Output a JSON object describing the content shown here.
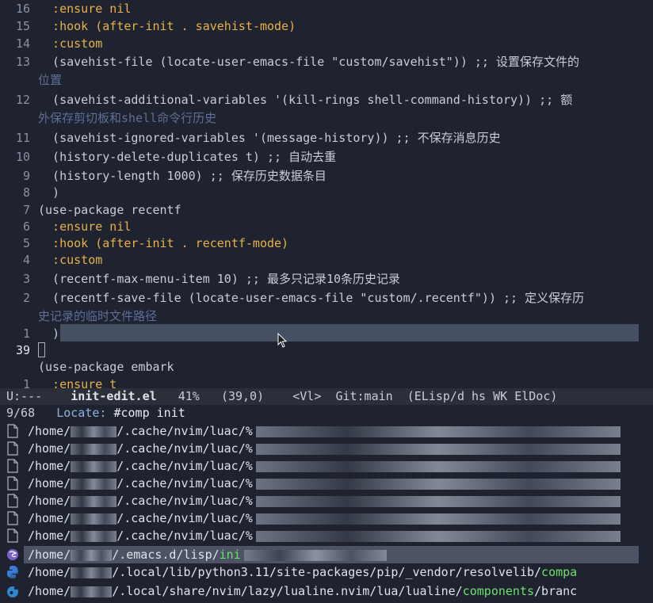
{
  "editor": {
    "lines": [
      {
        "num": "16",
        "text": "  :ensure nil"
      },
      {
        "num": "15",
        "text": "  :hook (after-init . savehist-mode)"
      },
      {
        "num": "14",
        "text": "  :custom"
      },
      {
        "num": "13",
        "text": "  (savehist-file (locate-user-emacs-file \"custom/savehist\")) ;; 设置保存文件的"
      },
      {
        "num": "",
        "text": "位置"
      },
      {
        "num": "12",
        "text": "  (savehist-additional-variables '(kill-rings shell-command-history)) ;; 额"
      },
      {
        "num": "",
        "text": "外保存剪切板和shell命令行历史"
      },
      {
        "num": "11",
        "text": "  (savehist-ignored-variables '(message-history)) ;; 不保存消息历史"
      },
      {
        "num": "10",
        "text": "  (history-delete-duplicates t) ;; 自动去重"
      },
      {
        "num": "9",
        "text": "  (history-length 1000) ;; 保存历史数据条目"
      },
      {
        "num": "8",
        "text": "  )"
      },
      {
        "num": "7",
        "text": "(use-package recentf"
      },
      {
        "num": "6",
        "text": "  :ensure nil"
      },
      {
        "num": "5",
        "text": "  :hook (after-init . recentf-mode)"
      },
      {
        "num": "4",
        "text": "  :custom"
      },
      {
        "num": "3",
        "text": "  (recentf-max-menu-item 10) ;; 最多只记录10条历史记录"
      },
      {
        "num": "2",
        "text": "  (recentf-save-file (locate-user-emacs-file \"custom/.recentf\")) ;; 定义保存历"
      },
      {
        "num": "",
        "text": "史记录的临时文件路径"
      },
      {
        "num": "1",
        "text": "  )"
      },
      {
        "num": "39",
        "text": ""
      },
      {
        "num": "",
        "text": "(use-package embark"
      },
      {
        "num": "1",
        "text": "  :ensure t"
      }
    ]
  },
  "modeline": {
    "state": "U:---",
    "buffer": "init-edit.el",
    "percent": "41%",
    "position": "(39,0)",
    "mode1": "<Vl>",
    "vc": "Git:main",
    "modes": "(ELisp/d hs WK ElDoc)"
  },
  "minibuffer": {
    "count": "9/68",
    "label": "Locate:",
    "input": "#comp init"
  },
  "candidates": [
    {
      "prefix": "/home/",
      "path": "/.cache/nvim/luac/%",
      "icon": "file-icon"
    },
    {
      "prefix": "/home/",
      "path": "/.cache/nvim/luac/%",
      "icon": "file-icon"
    },
    {
      "prefix": "/home/",
      "path": "/.cache/nvim/luac/%",
      "icon": "file-icon"
    },
    {
      "prefix": "/home/",
      "path": "/.cache/nvim/luac/%",
      "icon": "file-icon"
    },
    {
      "prefix": "/home/",
      "path": "/.cache/nvim/luac/%",
      "icon": "file-icon"
    },
    {
      "prefix": "/home/",
      "path": "/.cache/nvim/luac/%",
      "icon": "file-icon"
    },
    {
      "prefix": "/home/",
      "path": "/.cache/nvim/luac/%",
      "icon": "file-icon"
    },
    {
      "prefix": "/home/",
      "path": "/.emacs.d/lisp/",
      "match": "ini",
      "icon": "emacs-icon"
    },
    {
      "prefix": "/home/",
      "path": "/.local/lib/python3.11/site-packages/pip/_vendor/resolvelib/",
      "match": "compa",
      "icon": "python-icon"
    },
    {
      "prefix": "/home/",
      "path": "/.local/share/nvim/lazy/lualine.nvim/lua/lualine/",
      "match": "components",
      "tail": "/branc",
      "icon": "lua-icon"
    }
  ]
}
